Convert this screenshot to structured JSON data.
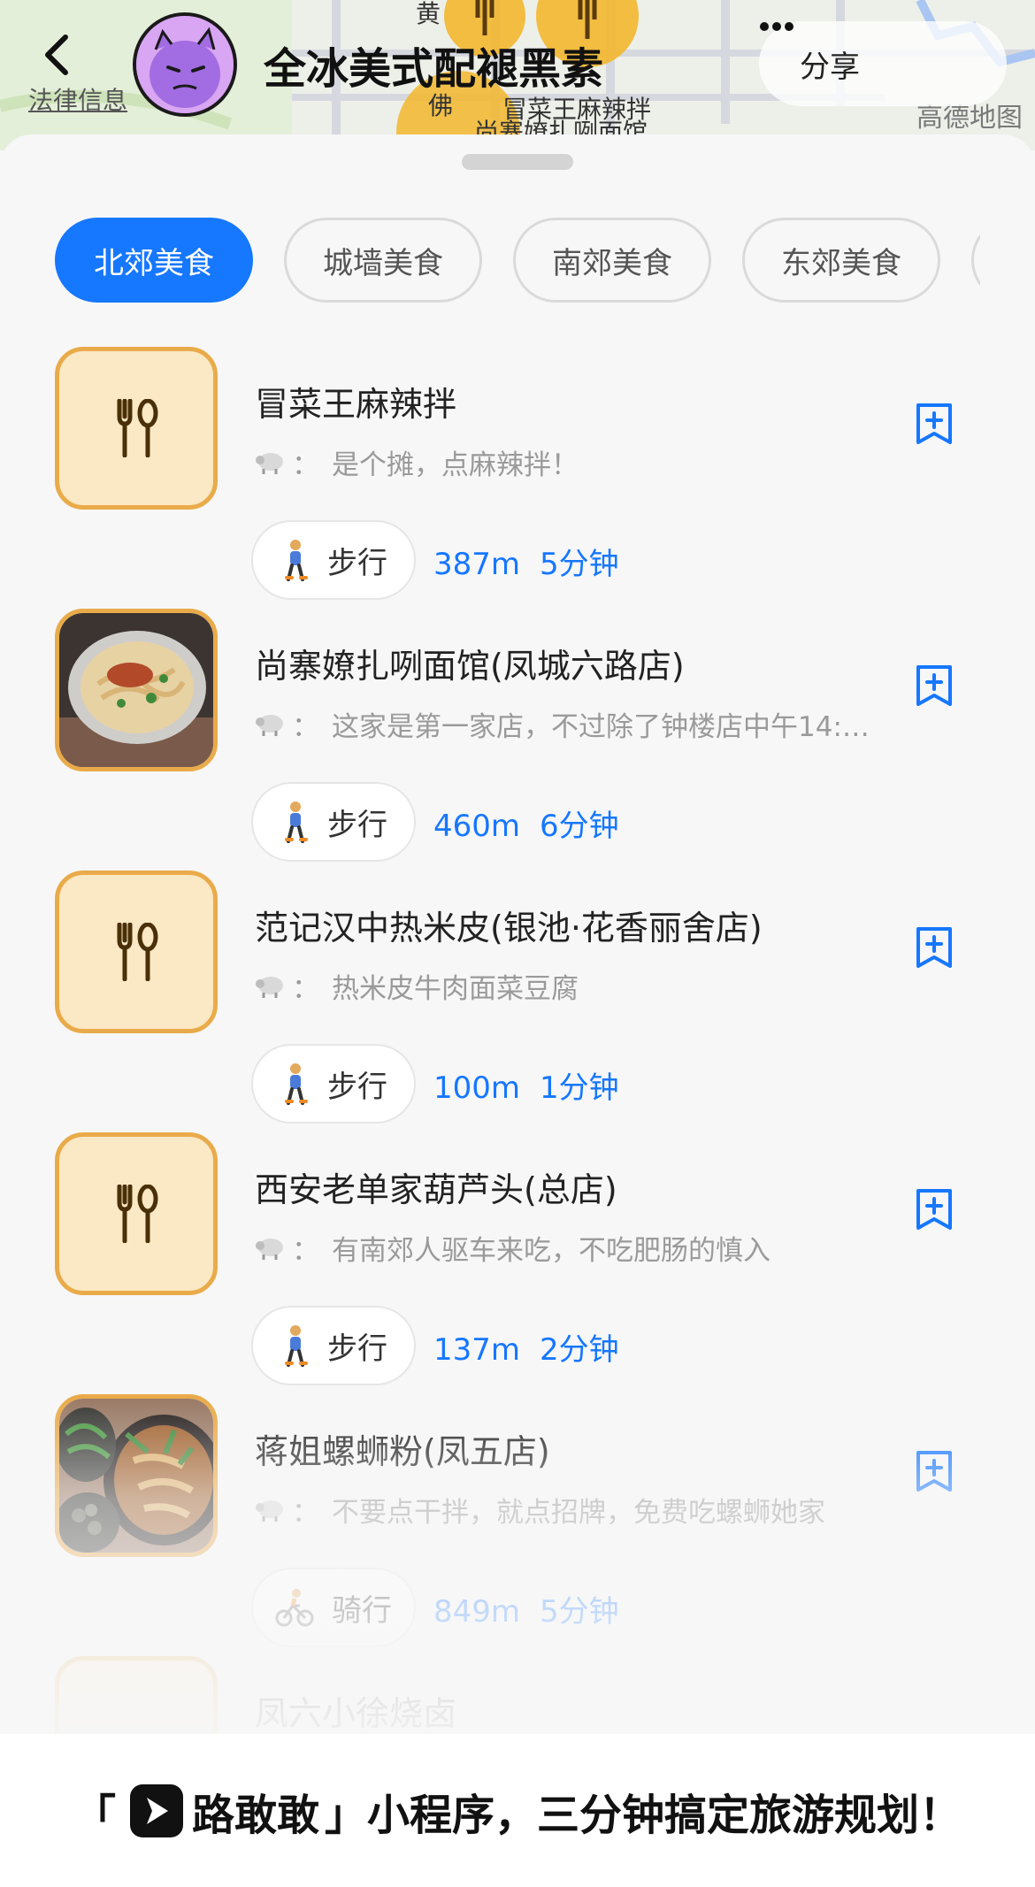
{
  "header": {
    "legal_link": "法律信息",
    "title": "全冰美式配褪黑素",
    "share_label": "分享",
    "map_provider": "高德地图",
    "map_labels": [
      "黄",
      "佛",
      "冒菜王麻辣拌",
      "尚寨嫽扎咧面馆"
    ]
  },
  "tabs": [
    "北郊美食",
    "城墙美食",
    "南郊美食",
    "东郊美食"
  ],
  "active_tab": "北郊美食",
  "items": [
    {
      "name": "冒菜王麻辣拌",
      "note": "是个摊，点麻辣拌！",
      "mode": "步行",
      "distance": "387m",
      "time": "5分钟",
      "thumb": "utensils-icon"
    },
    {
      "name": "尚寨嫽扎咧面馆(凤城六路店)",
      "note": "这家是第一家店，不过除了钟楼店中午14:…",
      "mode": "步行",
      "distance": "460m",
      "time": "6分钟",
      "thumb": "noodle-photo"
    },
    {
      "name": "范记汉中热米皮(银池·花香丽舍店)",
      "note": "热米皮牛肉面菜豆腐",
      "mode": "步行",
      "distance": "100m",
      "time": "1分钟",
      "thumb": "utensils-icon"
    },
    {
      "name": "西安老单家葫芦头(总店)",
      "note": "有南郊人驱车来吃，不吃肥肠的慎入",
      "mode": "步行",
      "distance": "137m",
      "time": "2分钟",
      "thumb": "utensils-icon"
    },
    {
      "name": "蒋姐螺蛳粉(凤五店)",
      "note": "不要点干拌，就点招牌，免费吃螺蛳她家",
      "mode": "骑行",
      "distance": "849m",
      "time": "5分钟",
      "thumb": "snail-noodle-photo"
    },
    {
      "name": "凤六小徐烧卤"
    }
  ],
  "note_colon": "：",
  "footer": {
    "open_quote": "「",
    "brand": "路敢敢",
    "close_quote": "」",
    "slogan": "小程序，三分钟搞定旅游规划！"
  },
  "colors": {
    "accent": "#1677ff",
    "thumb_border": "#e9ab4a",
    "thumb_bg": "#fbe8c4"
  }
}
